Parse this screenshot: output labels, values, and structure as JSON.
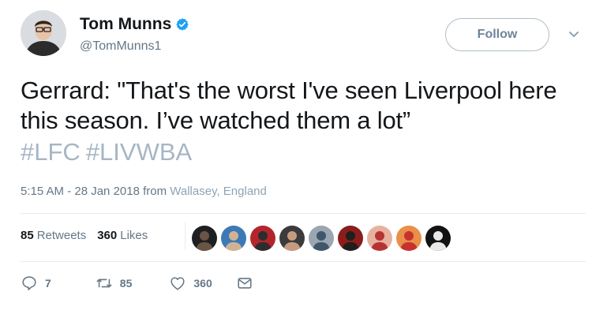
{
  "author": {
    "name": "Tom Munns",
    "handle": "@TomMunns1",
    "verified": true
  },
  "follow_button": {
    "label": "Follow"
  },
  "tweet": {
    "text": "Gerrard: \"That's the worst I've seen Liverpool here this season. I’ve watched them a lot”",
    "hashtags": [
      "#LFC",
      "#LIVWBA"
    ],
    "time": "5:15 AM - 28 Jan 2018",
    "from_label": "from",
    "location": "Wallasey, England"
  },
  "stats": {
    "retweets_count": "85",
    "retweets_label": "Retweets",
    "likes_count": "360",
    "likes_label": "Likes"
  },
  "liker_avatars": [
    {
      "bg": "#1e1f22",
      "fg": "#6a5446"
    },
    {
      "bg": "#3d79b6",
      "fg": "#d0b394"
    },
    {
      "bg": "#b3252c",
      "fg": "#2d2d2d"
    },
    {
      "bg": "#3b3b3b",
      "fg": "#c69c7f"
    },
    {
      "bg": "#9aa6b1",
      "fg": "#40566a"
    },
    {
      "bg": "#8c1d1d",
      "fg": "#221e1c"
    },
    {
      "bg": "#e7b1a0",
      "fg": "#b73333"
    },
    {
      "bg": "#e88f4a",
      "fg": "#c7322f"
    },
    {
      "bg": "#121212",
      "fg": "#e8e8e8"
    }
  ],
  "actions": {
    "reply_count": "7",
    "retweet_count": "85",
    "like_count": "360"
  },
  "colors": {
    "verified_blue": "#1da1f2",
    "hashtag": "#a6b6c4",
    "secondary_text": "#657786"
  }
}
